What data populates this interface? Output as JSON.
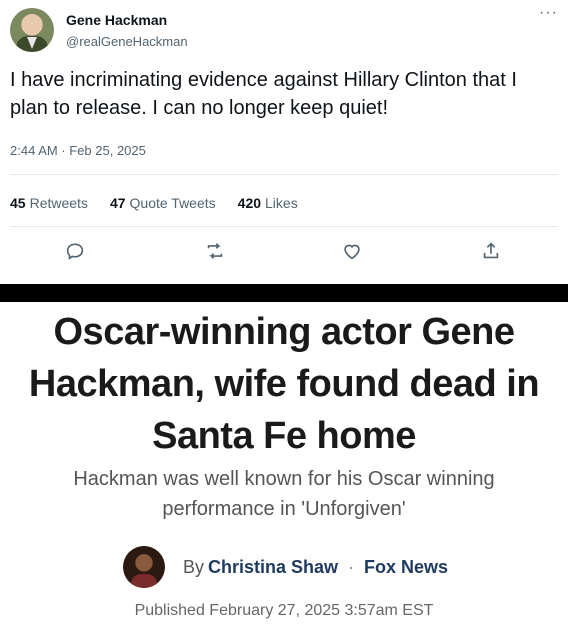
{
  "tweet": {
    "user_name": "Gene Hackman",
    "handle": "@realGeneHackman",
    "more_label": "···",
    "text": "I have incriminating evidence against Hillary Clinton that I plan to release. I can no longer keep quiet!",
    "timestamp": "2:44 AM · Feb 25, 2025",
    "stats": [
      {
        "count": "45",
        "label": "Retweets"
      },
      {
        "count": "47",
        "label": "Quote Tweets"
      },
      {
        "count": "420",
        "label": "Likes"
      }
    ],
    "actions": [
      "reply-icon",
      "retweet-icon",
      "like-icon",
      "share-icon"
    ]
  },
  "article": {
    "headline": "Oscar-winning actor Gene Hackman, wife found dead in Santa Fe home",
    "subheadline": "Hackman was well known for his Oscar winning performance in 'Unforgiven'",
    "by_label": "By",
    "author": "Christina Shaw",
    "separator": "·",
    "outlet": "Fox News",
    "published": "Published February 27, 2025 3:57am EST"
  },
  "colors": {
    "link_blue": "#1f3a5f",
    "muted_gray": "#536471",
    "separator_black": "#000000"
  }
}
